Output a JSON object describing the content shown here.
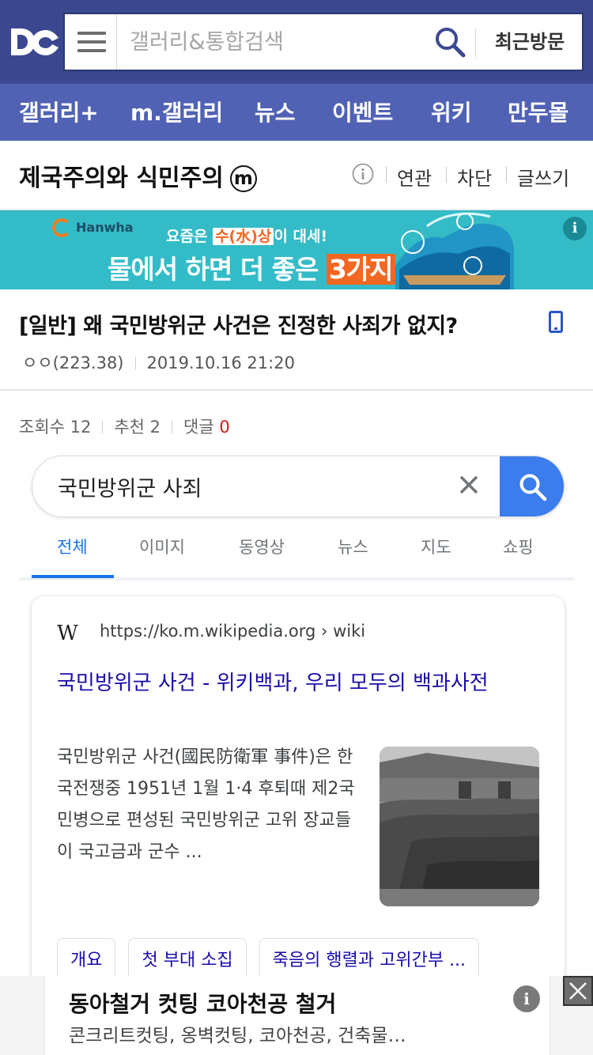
{
  "header": {
    "search_placeholder": "갤러리&통합검색",
    "recent_label": "최근방문"
  },
  "nav": {
    "items": [
      {
        "label": "갤러리+"
      },
      {
        "label": "m.갤러리"
      },
      {
        "label": "뉴스"
      },
      {
        "label": "이벤트"
      },
      {
        "label": "위키"
      },
      {
        "label": "만두몰"
      }
    ]
  },
  "gallery": {
    "title": "제국주의와 식민주의",
    "badge": "m",
    "links": [
      "연관",
      "차단",
      "글쓰기"
    ]
  },
  "banner": {
    "brand": "Hanwha",
    "line1_pre": "요즘은 ",
    "line1_hl": "수(水)상",
    "line1_post": "이 대세!",
    "line2_pre": "물에서 하면 더 좋은 ",
    "line2_hl": "3가지",
    "info": "i"
  },
  "post": {
    "title": "[일반] 왜 국민방위군 사건은 진정한 사죄가 없지?",
    "author": "ㅇㅇ(223.38)",
    "date": "2019.10.16 21:20",
    "views_label": "조회수 12",
    "recommend_label": "추천 2",
    "comments_label": "댓글 ",
    "comments_count": "0"
  },
  "google": {
    "query": "국민방위군 사죄",
    "tabs": [
      "전체",
      "이미지",
      "동영상",
      "뉴스",
      "지도",
      "쇼핑"
    ],
    "active_tab": "전체",
    "result": {
      "site_logo": "W",
      "url": "https://ko.m.wikipedia.org › wiki",
      "title": "국민방위군 사건 - 위키백과, 우리 모두의 백과사전",
      "snippet": "국민방위군 사건(國民防衛軍 事件)은 한국전쟁중 1951년 1월 1·4 후퇴때 제2국민병으로 편성된 국민방위군 고위 장교들이 국고금과 군수 ...",
      "chips": [
        "개요",
        "첫 부대 소집",
        "죽음의 행렬과 고위간부 ..."
      ]
    }
  },
  "ad": {
    "title": "동아철거 컷팅 코아천공 철거",
    "desc": "콘크리트컷팅, 옹벽컷팅, 코아천공, 건축물…",
    "info": "i"
  }
}
